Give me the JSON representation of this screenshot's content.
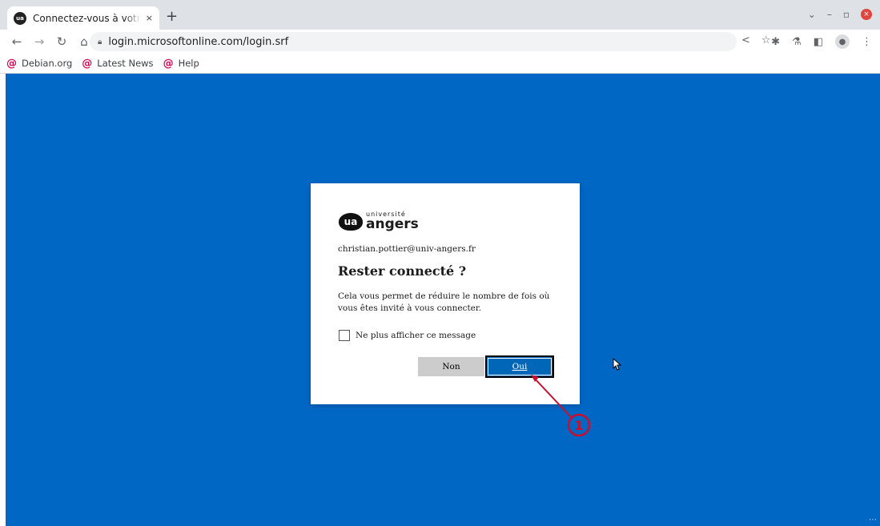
{
  "browser": {
    "tab_title": "Connectez-vous à votre compte",
    "favicon_label": "ua",
    "tab_close": "×",
    "new_tab": "+",
    "url": "login.microsoftonline.com/login.srf",
    "window_controls": [
      "⌄",
      "–",
      "▫"
    ],
    "window_close": "×"
  },
  "bookmarks": [
    {
      "label": "Debian.org",
      "icon": "debian-swirl-icon"
    },
    {
      "label": "Latest News",
      "icon": "debian-swirl-icon"
    },
    {
      "label": "Help",
      "icon": "debian-swirl-icon"
    }
  ],
  "dialog": {
    "logo_small": "université",
    "logo_big": "angers",
    "logo_mark": "ua",
    "email": "christian.pottier@univ-angers.fr",
    "title": "Rester connecté ?",
    "description": "Cela vous permet de réduire le nombre de fois où vous êtes invité à vous connecter.",
    "checkbox_label": "Ne plus afficher ce message",
    "checkbox_checked": false,
    "button_no": "Non",
    "button_yes": "Oui"
  },
  "annotation": {
    "number": "1",
    "color": "#c8102e"
  },
  "colors": {
    "page_background": "#0067c5",
    "primary_button": "#0067b8",
    "secondary_button": "#cccccc"
  }
}
